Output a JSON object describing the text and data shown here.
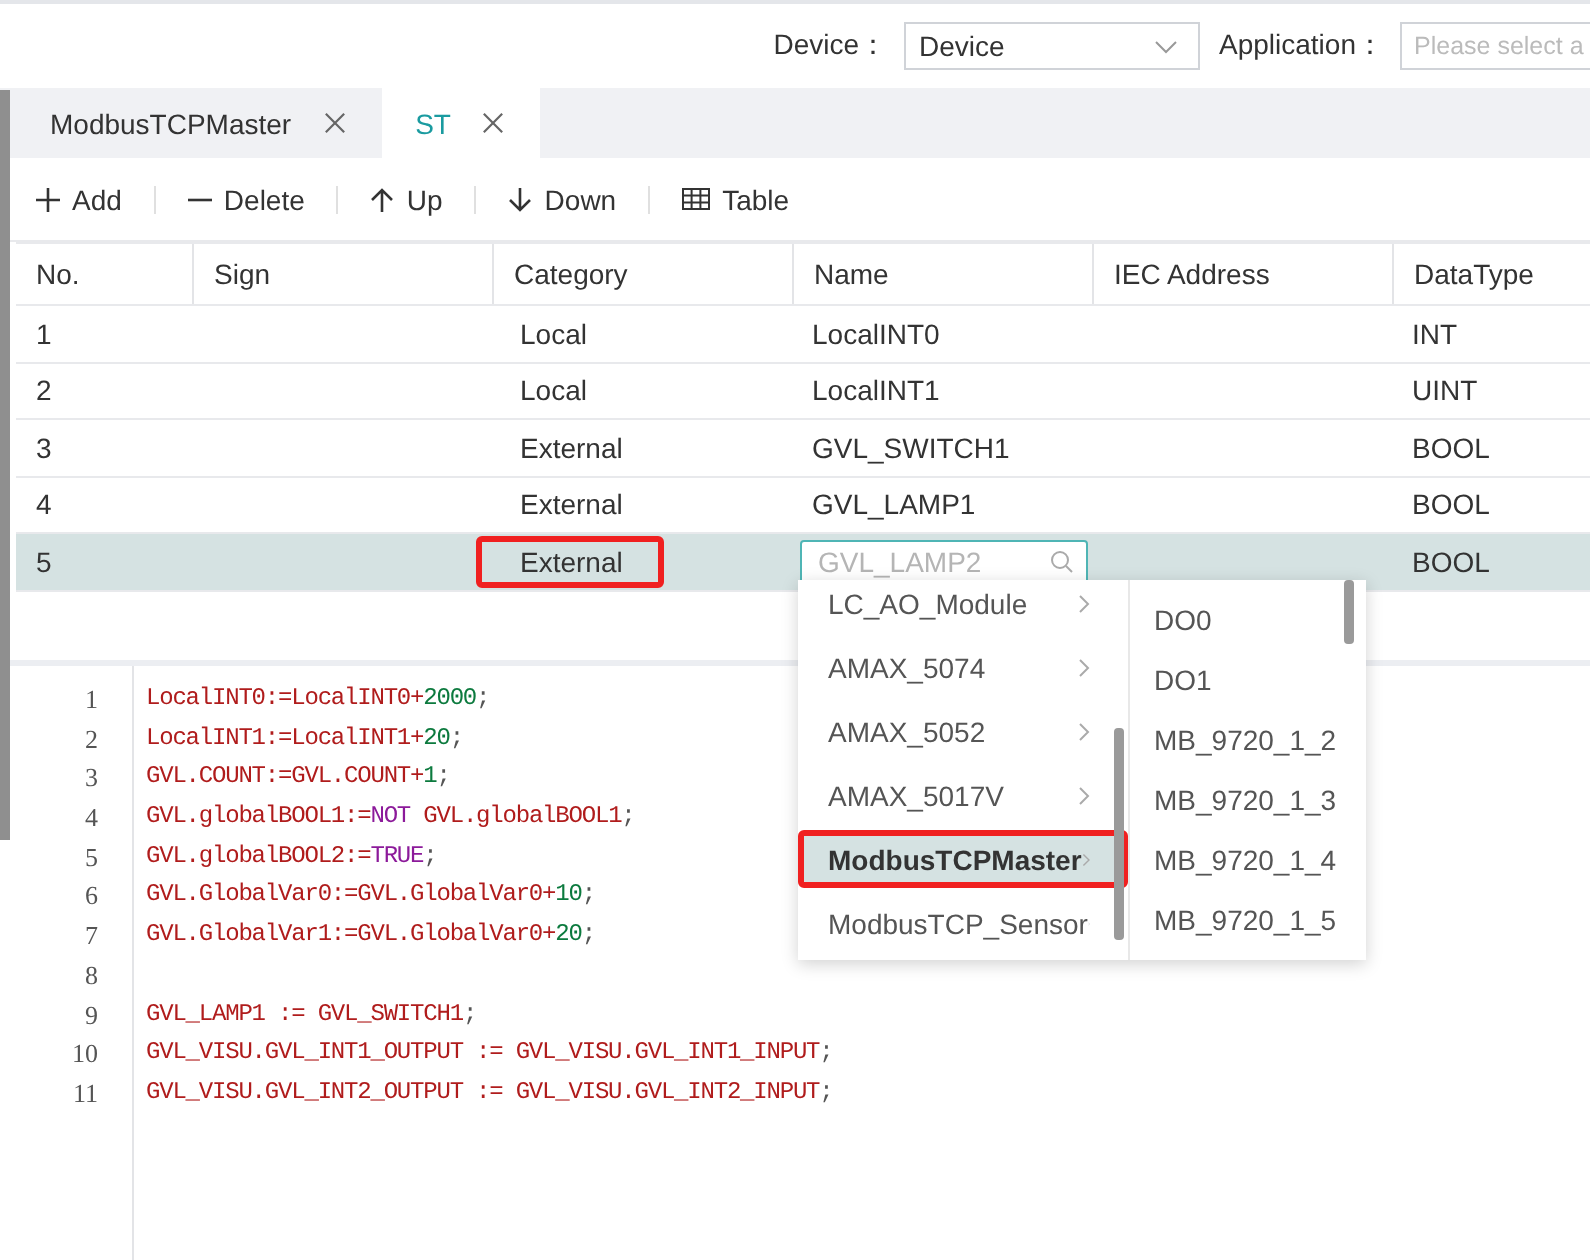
{
  "topbar": {
    "device_label": "Device：",
    "device_value": "Device",
    "application_label": "Application：",
    "application_placeholder": "Please select a"
  },
  "tabs": [
    {
      "label": "ModbusTCPMaster",
      "selected": false
    },
    {
      "label": "ST",
      "selected": true
    }
  ],
  "actions": [
    {
      "label": "Add",
      "kind": "add"
    },
    {
      "label": "Delete",
      "kind": "delete"
    },
    {
      "label": "Up",
      "kind": "up"
    },
    {
      "label": "Down",
      "kind": "down"
    },
    {
      "label": "Table",
      "kind": "table"
    }
  ],
  "table": {
    "columns": [
      "No.",
      "Sign",
      "Category",
      "Name",
      "IEC Address",
      "DataType"
    ],
    "rows": [
      {
        "no": "1",
        "category": "Local",
        "name": "LocalINT0",
        "datatype": "INT",
        "selected": false,
        "category_marked": false
      },
      {
        "no": "2",
        "category": "Local",
        "name": "LocalINT1",
        "datatype": "UINT",
        "selected": false,
        "category_marked": false
      },
      {
        "no": "3",
        "category": "External",
        "name": "GVL_SWITCH1",
        "datatype": "BOOL",
        "selected": false,
        "category_marked": false
      },
      {
        "no": "4",
        "category": "External",
        "name": "GVL_LAMP1",
        "datatype": "BOOL",
        "selected": false,
        "category_marked": false
      },
      {
        "no": "5",
        "category": "External",
        "name_field": {
          "placeholder": "GVL_LAMP2"
        },
        "datatype": "BOOL",
        "selected": true,
        "category_marked": true
      }
    ]
  },
  "dropdown": {
    "groups": [
      {
        "label": "LC_AO_Module",
        "selected": false,
        "marked": false
      },
      {
        "label": "AMAX_5074",
        "selected": false,
        "marked": false
      },
      {
        "label": "AMAX_5052",
        "selected": false,
        "marked": false
      },
      {
        "label": "AMAX_5017V",
        "selected": false,
        "marked": false
      },
      {
        "label": "ModbusTCPMaster",
        "selected": true,
        "marked": true
      },
      {
        "label": "ModbusTCP_Sensor",
        "selected": false,
        "marked": false
      }
    ],
    "items": [
      "DO0",
      "DO1",
      "MB_9720_1_2",
      "MB_9720_1_3",
      "MB_9720_1_4",
      "MB_9720_1_5"
    ]
  },
  "editor": {
    "lines": [
      {
        "number": "1",
        "tokens": [
          {
            "text": "LocalINT0:=LocalINT0+",
            "kind": "var"
          },
          {
            "text": "2000",
            "kind": "num"
          },
          {
            "text": ";",
            "kind": "punct"
          }
        ]
      },
      {
        "number": "2",
        "tokens": [
          {
            "text": "LocalINT1:=LocalINT1+",
            "kind": "var"
          },
          {
            "text": "20",
            "kind": "num"
          },
          {
            "text": ";",
            "kind": "punct"
          }
        ]
      },
      {
        "number": "3",
        "tokens": [
          {
            "text": "GVL.COUNT:=GVL.COUNT+",
            "kind": "var"
          },
          {
            "text": "1",
            "kind": "num"
          },
          {
            "text": ";",
            "kind": "punct"
          }
        ]
      },
      {
        "number": "4",
        "tokens": [
          {
            "text": "GVL.globalBOOL1:=",
            "kind": "var"
          },
          {
            "text": "NOT",
            "kind": "kw"
          },
          {
            "text": " GVL.globalBOOL1",
            "kind": "var"
          },
          {
            "text": ";",
            "kind": "punct"
          }
        ]
      },
      {
        "number": "5",
        "tokens": [
          {
            "text": "GVL.globalBOOL2:=",
            "kind": "var"
          },
          {
            "text": "TRUE",
            "kind": "kw"
          },
          {
            "text": ";",
            "kind": "punct"
          }
        ]
      },
      {
        "number": "6",
        "tokens": [
          {
            "text": "GVL.GlobalVar0:=GVL.GlobalVar0+",
            "kind": "var"
          },
          {
            "text": "10",
            "kind": "num"
          },
          {
            "text": ";",
            "kind": "punct"
          }
        ]
      },
      {
        "number": "7",
        "tokens": [
          {
            "text": "GVL.GlobalVar1:=GVL.GlobalVar0+",
            "kind": "var"
          },
          {
            "text": "20",
            "kind": "num"
          },
          {
            "text": ";",
            "kind": "punct"
          }
        ]
      },
      {
        "number": "8"
      },
      {
        "number": "9",
        "tokens": [
          {
            "text": "GVL_LAMP1 := GVL_SWITCH1",
            "kind": "var"
          },
          {
            "text": ";",
            "kind": "punct"
          }
        ]
      },
      {
        "number": "10",
        "tokens": [
          {
            "text": "GVL_VISU.GVL_INT1_OUTPUT := GVL_VISU.GVL_INT1_INPUT",
            "kind": "var"
          },
          {
            "text": ";",
            "kind": "punct"
          }
        ]
      },
      {
        "number": "11",
        "tokens": [
          {
            "text": "GVL_VISU.GVL_INT2_OUTPUT := GVL_VISU.GVL_INT2_INPUT",
            "kind": "var"
          },
          {
            "text": ";",
            "kind": "punct"
          }
        ]
      }
    ]
  }
}
